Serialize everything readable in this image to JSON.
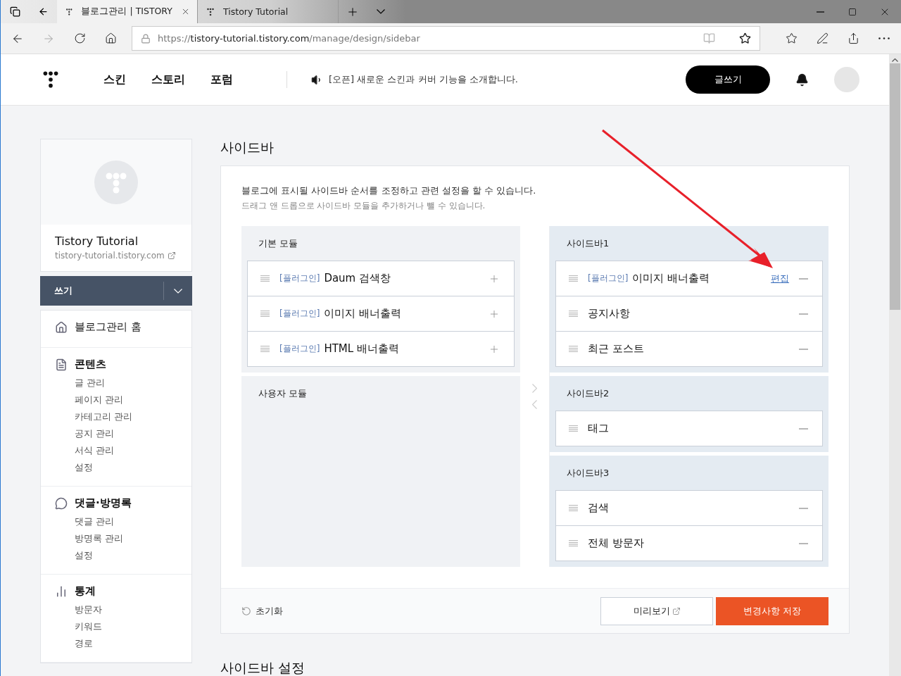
{
  "browser": {
    "tabs": [
      {
        "title": "블로그관리 | TISTORY",
        "selected": true
      },
      {
        "title": "Tistory Tutorial",
        "selected": false
      }
    ],
    "url": {
      "scheme": "https://",
      "host": "tistory-tutorial.tistory.com",
      "path": "/manage/design/sidebar"
    }
  },
  "header": {
    "nav": [
      "스킨",
      "스토리",
      "포럼"
    ],
    "notice": "[오픈] 새로운 스킨과 커버 기능을 소개합니다.",
    "write_button": "글쓰기"
  },
  "blog": {
    "name": "Tistory Tutorial",
    "address": "tistory-tutorial.tistory.com",
    "write_button": "쓰기"
  },
  "menu": [
    {
      "kind": "home",
      "title": "블로그관리 홈"
    },
    {
      "kind": "document",
      "title": "콘텐츠",
      "items": [
        "글 관리",
        "페이지 관리",
        "카테고리 관리",
        "공지 관리",
        "서식 관리",
        "설정"
      ]
    },
    {
      "kind": "comment",
      "title": "댓글·방명록",
      "items": [
        "댓글 관리",
        "방명록 관리",
        "설정"
      ]
    },
    {
      "kind": "chart",
      "title": "통계",
      "items": [
        "방문자",
        "키워드",
        "경로"
      ]
    }
  ],
  "page": {
    "title": "사이드바",
    "description": "블로그에 표시될 사이드바 순서를 조정하고 관련 설정을 할 수 있습니다.",
    "hint": "드래그 앤 드롭으로 사이드바 모듈을 추가하거나 뺄 수 있습니다.",
    "basic_modules": {
      "title": "기본 모듈",
      "items": [
        {
          "tag": "[플러그인]",
          "name": "Daum 검색창"
        },
        {
          "tag": "[플러그인]",
          "name": "이미지 배너출력"
        },
        {
          "tag": "[플러그인]",
          "name": "HTML 배너출력"
        }
      ]
    },
    "user_modules": {
      "title": "사용자 모듈"
    },
    "sidebars": [
      {
        "title": "사이드바1",
        "items": [
          {
            "tag": "[플러그인]",
            "name": "이미지 배너출력",
            "edit": "편집"
          },
          {
            "name": "공지사항"
          },
          {
            "name": "최근 포스트"
          }
        ]
      },
      {
        "title": "사이드바2",
        "items": [
          {
            "name": "태그"
          }
        ]
      },
      {
        "title": "사이드바3",
        "items": [
          {
            "name": "검색"
          },
          {
            "name": "전체 방문자"
          }
        ]
      }
    ],
    "reset": "초기화",
    "preview": "미리보기",
    "save": "변경사항 저장"
  },
  "next_section": "사이드바 설정"
}
